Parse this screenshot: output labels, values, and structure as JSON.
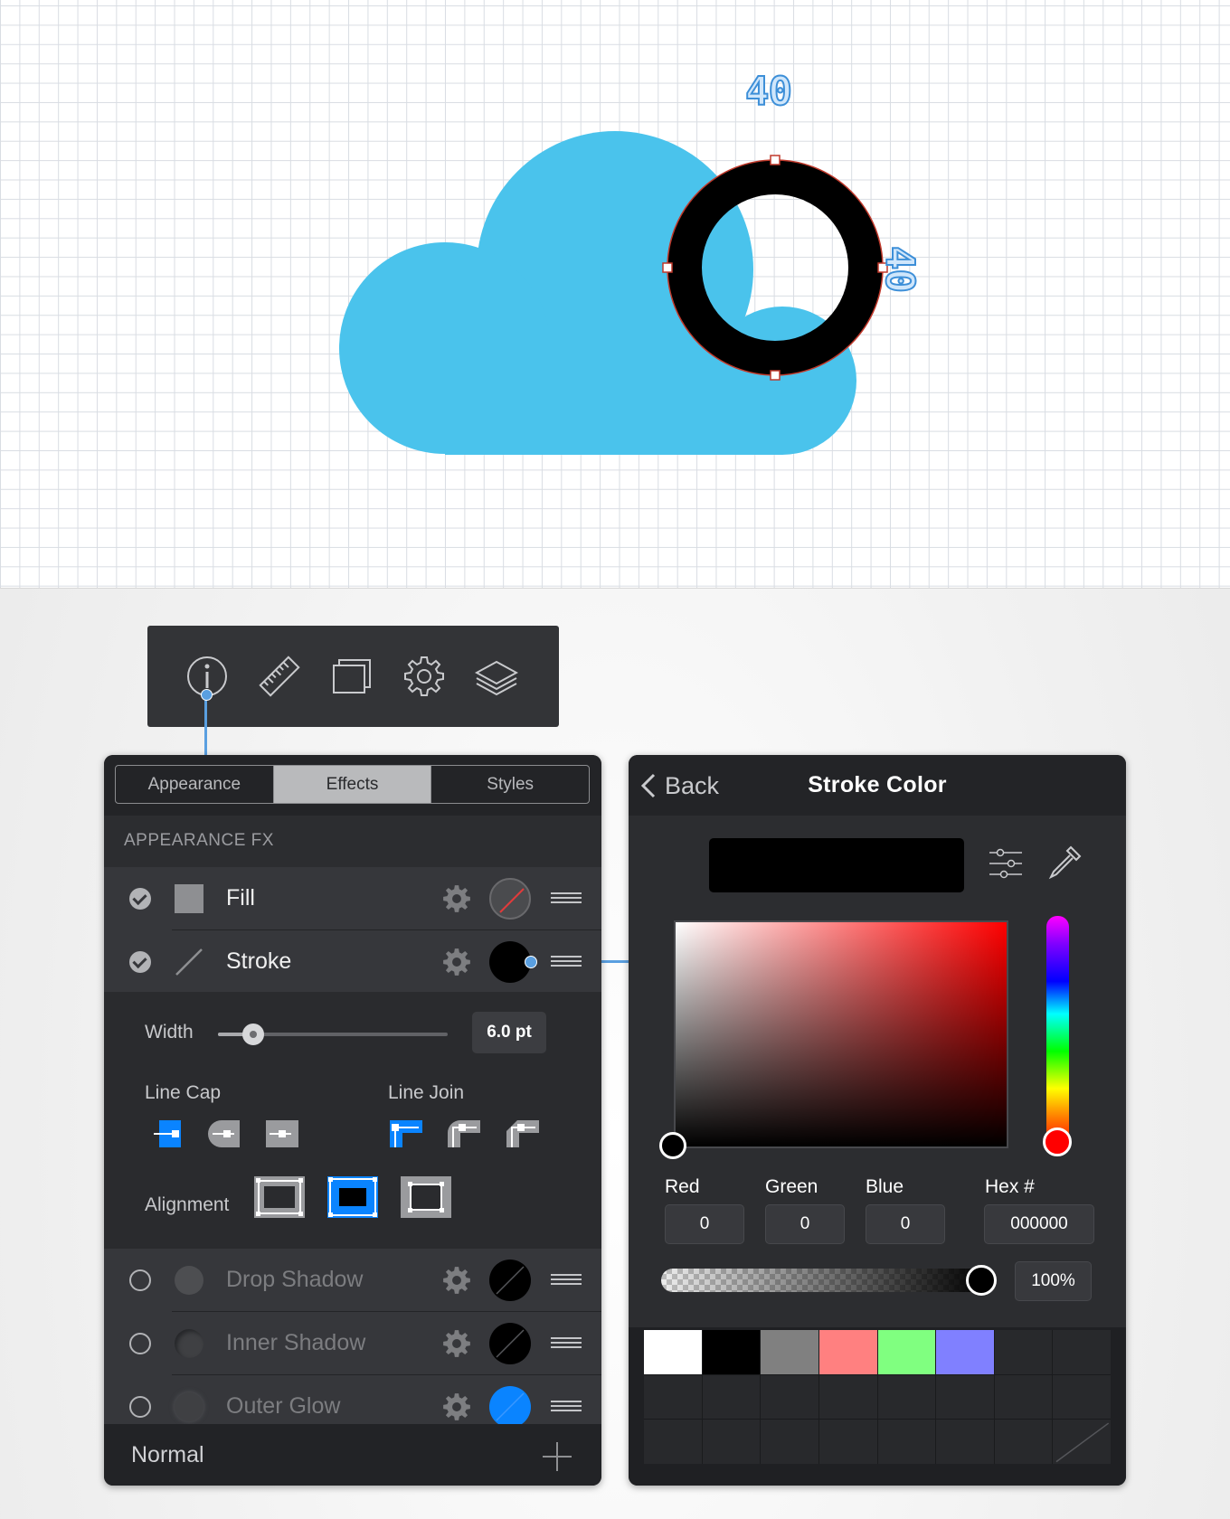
{
  "canvas": {
    "dimension_width": "40",
    "dimension_height": "40",
    "colors": {
      "cloud": "#4ac3ec",
      "ring": "#000000",
      "selection": "#c0392b"
    }
  },
  "toolbar": {
    "icons": [
      "info-icon",
      "ruler-icon",
      "artboard-icon",
      "gear-icon",
      "layers-icon"
    ]
  },
  "left_panel": {
    "tabs": [
      "Appearance",
      "Effects",
      "Styles"
    ],
    "active_tab": "Effects",
    "section_header": "APPEARANCE FX",
    "rows": [
      {
        "label": "Fill",
        "enabled": true,
        "swatch": "none"
      },
      {
        "label": "Stroke",
        "enabled": true,
        "swatch": "#000000"
      },
      {
        "label": "Drop Shadow",
        "enabled": false,
        "swatch": "#000000"
      },
      {
        "label": "Inner Shadow",
        "enabled": false,
        "swatch": "#000000"
      },
      {
        "label": "Outer Glow",
        "enabled": false,
        "swatch": "#0a84ff"
      }
    ],
    "stroke": {
      "width_label": "Width",
      "width_value": "6.0 pt",
      "width_fraction": 0.16,
      "line_cap_label": "Line Cap",
      "line_join_label": "Line Join",
      "alignment_label": "Alignment",
      "selected_cap": 0,
      "selected_join": 0,
      "selected_alignment": 1
    },
    "footer": {
      "blend_mode": "Normal"
    }
  },
  "right_panel": {
    "back_label": "Back",
    "title": "Stroke Color",
    "current_color": "#000000",
    "fields": {
      "red_label": "Red",
      "red": "0",
      "green_label": "Green",
      "green": "0",
      "blue_label": "Blue",
      "blue": "0",
      "hex_label": "Hex #",
      "hex": "000000"
    },
    "hue": "#ff0000",
    "opacity": "100%",
    "swatches": [
      "#ffffff",
      "#000000",
      "#808080",
      "#ff8080",
      "#80ff80",
      "#8080ff"
    ]
  },
  "accent_color": "#0a84ff"
}
